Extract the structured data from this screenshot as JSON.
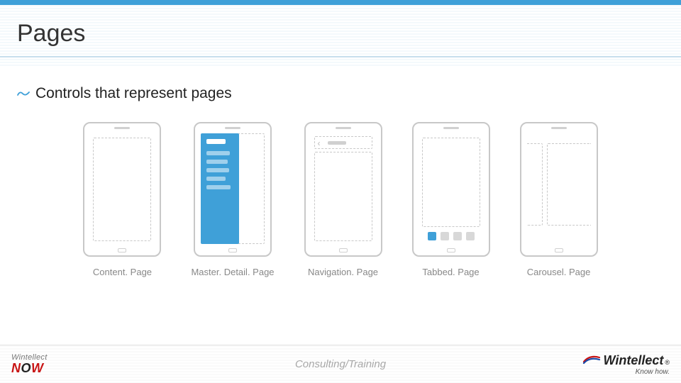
{
  "title": "Pages",
  "bullet": "Controls that represent pages",
  "pages": [
    {
      "label": "Content. Page"
    },
    {
      "label": "Master. Detail. Page"
    },
    {
      "label": "Navigation. Page"
    },
    {
      "label": "Tabbed. Page"
    },
    {
      "label": "Carousel. Page"
    }
  ],
  "footer": {
    "left_top": "Wintellect",
    "left_bottom_a": "N",
    "left_bottom_b": "O",
    "left_bottom_c": "W",
    "center": "Consulting/Training",
    "right_brand": "Wintellect",
    "right_reg": "®",
    "right_tag": "Know how."
  }
}
